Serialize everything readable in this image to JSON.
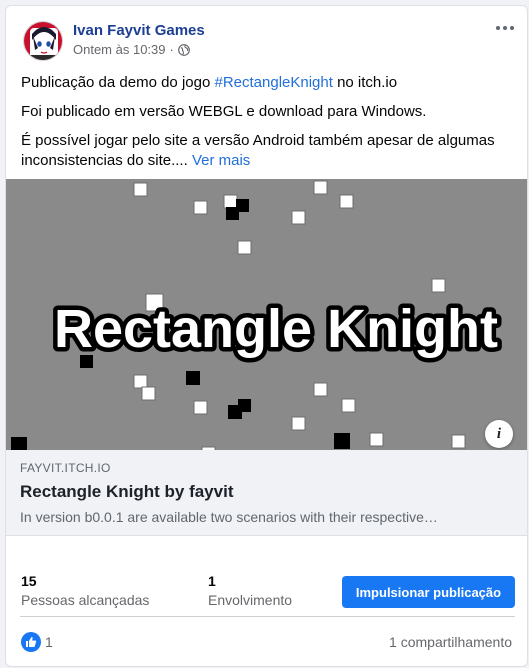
{
  "post": {
    "author": "Ivan Fayvit Games",
    "timestamp": "Ontem às 10:39",
    "separator": "·",
    "privacy_icon": "globe-icon",
    "more_icon": "more-horizontal-icon",
    "lines": [
      {
        "before": "Publicação da demo do jogo ",
        "hashtag": "#RectangleKnight",
        "after": " no itch.io"
      },
      {
        "text": "Foi publicado em versão WEBGL e download para Windows."
      },
      {
        "text": "É possível jogar pelo site a versão Android também apesar de algumas inconsistencias do site....",
        "see_more": "Ver mais"
      }
    ]
  },
  "link_preview": {
    "image_title": "Rectangle Knight",
    "domain": "FAYVIT.ITCH.IO",
    "title": "Rectangle Knight by fayvit",
    "description": "In version b0.0.1 are available two scenarios with their respective…",
    "info_label": "i"
  },
  "stats": {
    "reach_value": "15",
    "reach_label": "Pessoas alcançadas",
    "engagement_value": "1",
    "engagement_label": "Envolvimento",
    "boost_label": "Impulsionar publicação"
  },
  "reactions": {
    "like_count": "1",
    "shares": "1 compartilhamento"
  },
  "colors": {
    "accent": "#1877f2",
    "author": "#1c3f94",
    "link": "#216fdb",
    "preview_bg": "#8a8a8a"
  }
}
